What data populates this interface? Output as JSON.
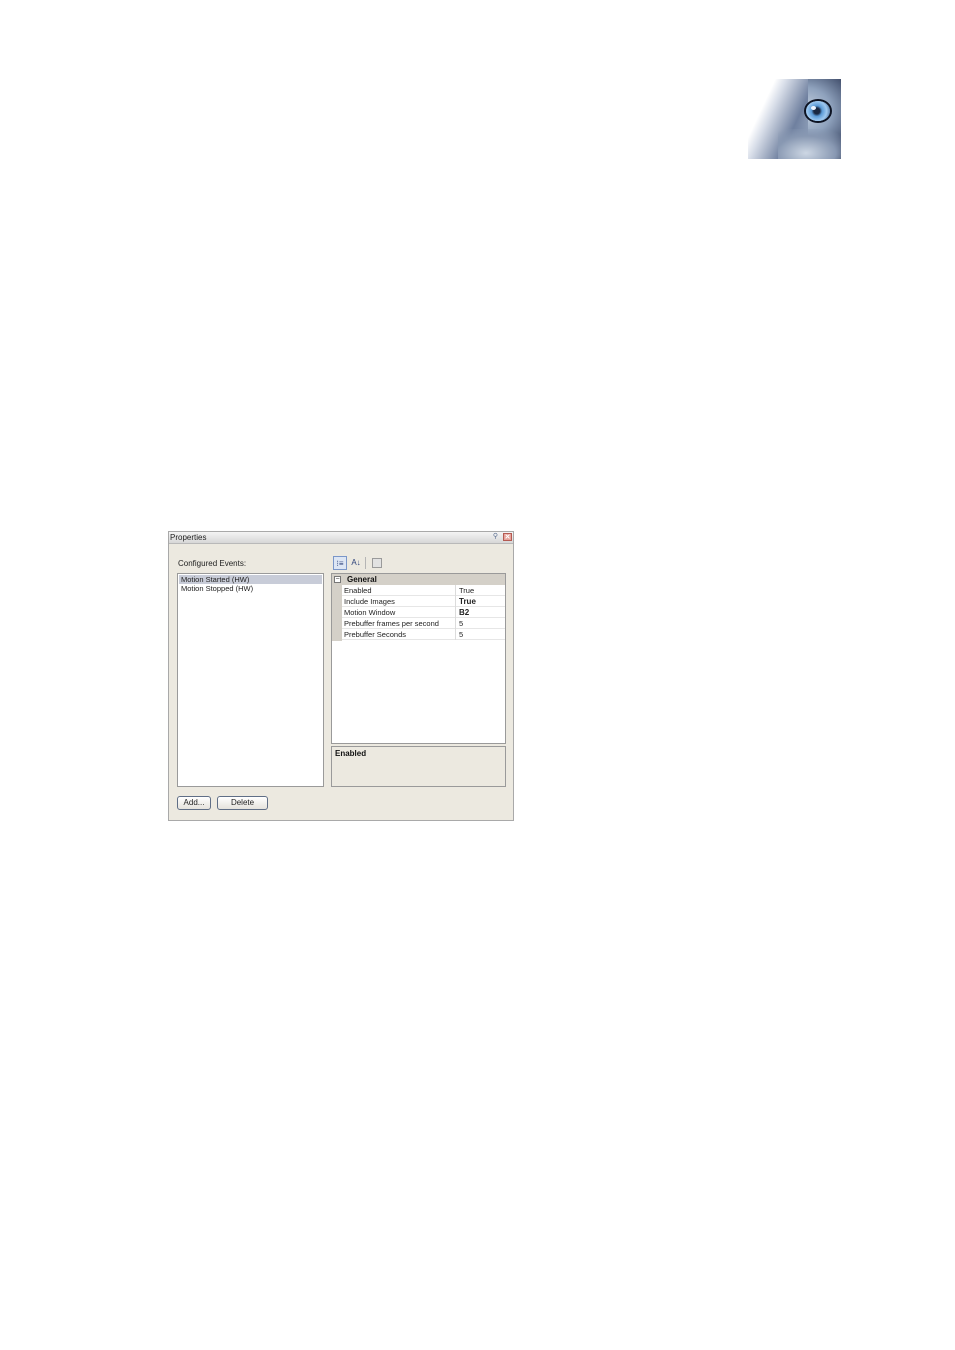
{
  "logo": {
    "icon": "wolf-eye-logo"
  },
  "window": {
    "title": "Properties",
    "pin_icon": "pin-icon",
    "close_icon": "close-icon",
    "pin_glyph": "⚲",
    "close_glyph": "✕"
  },
  "events": {
    "label": "Configured Events:",
    "items": [
      {
        "label": "Motion Started (HW)",
        "selected": true
      },
      {
        "label": "Motion Stopped (HW)",
        "selected": false
      }
    ]
  },
  "toolbar": {
    "categorized_icon": "categorized-icon",
    "alphabetical_icon": "sort-alphabetical-icon",
    "property_pages_icon": "property-pages-icon",
    "categorized_glyph": "⁝≡",
    "alphabetical_glyph": "A↓"
  },
  "property_grid": {
    "category": "General",
    "toggle": "−",
    "rows": [
      {
        "name": "Enabled",
        "value": "True",
        "bold": false
      },
      {
        "name": "Include Images",
        "value": "True",
        "bold": true
      },
      {
        "name": "Motion Window",
        "value": "B2",
        "bold": true
      },
      {
        "name": "Prebuffer frames per second",
        "value": "5",
        "bold": false
      },
      {
        "name": "Prebuffer Seconds",
        "value": "5",
        "bold": false
      }
    ]
  },
  "help": {
    "title": "Enabled"
  },
  "buttons": {
    "add": "Add...",
    "delete": "Delete"
  }
}
